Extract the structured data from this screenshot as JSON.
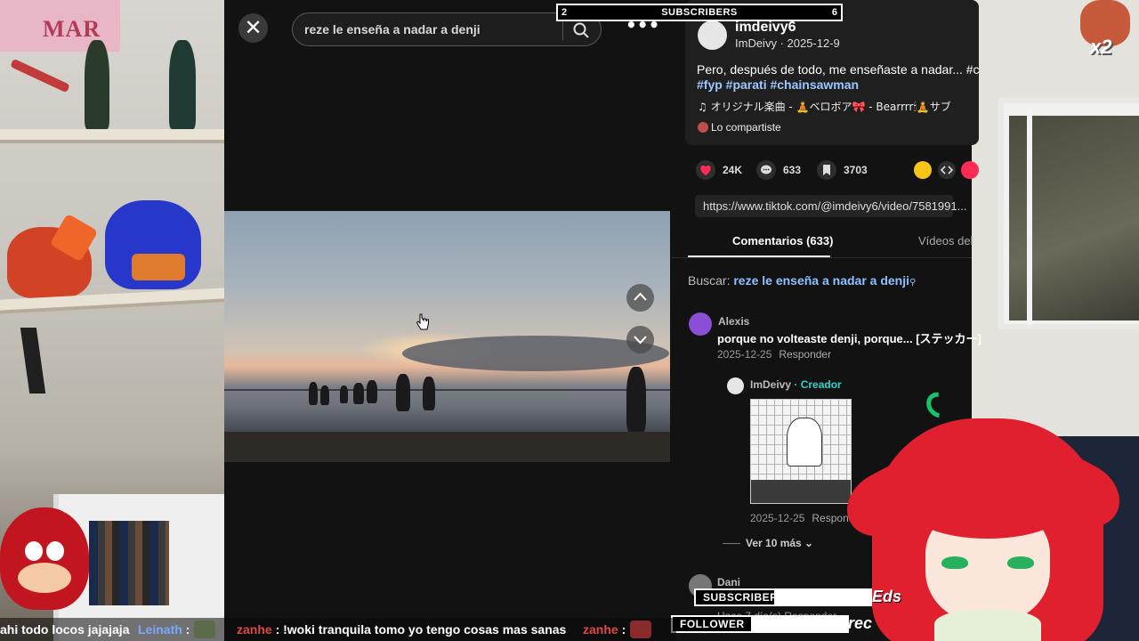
{
  "search": {
    "query": "reze le enseña a nadar a denji"
  },
  "post": {
    "handle": "imdeivy6",
    "author_line": "ImDeivy · 2025-12-9",
    "description": "Pero, después de todo, me enseñaste a nadar... #c",
    "hashtags": "#fyp #parati #chainsawman",
    "music": "♫  オリジナル楽曲 - 🧘ベロボア🎀 - Bearrrr🕯🧘サブ",
    "shared": "Lo compartiste",
    "likes": "24K",
    "comments": "633",
    "saves": "3703",
    "link": "https://www.tiktok.com/@imdeivy6/video/7581991..."
  },
  "tabs": {
    "comments": "Comentarios (633)",
    "videos": "Vídeos del"
  },
  "comment_search": {
    "prefix": "Buscar:",
    "query": "reze le enseña a nadar a denji"
  },
  "comments": [
    {
      "name": "Alexis",
      "text": "porque no volteaste denji, porque... [ステッカー]",
      "date": "2025-12-25",
      "reply": "Responder"
    },
    {
      "name": "ImDeivy",
      "tag": "· Creador",
      "date": "2025-12-25",
      "reply": "Responder"
    },
    {
      "name": "Dani",
      "meta": "Hace 7 día(s)   Responder"
    }
  ],
  "more_replies": "Ver 10 más",
  "overlay": {
    "subs_left": "2",
    "subs_title": "SUBSCRIBERS",
    "subs_right": "6",
    "subs_label": "SUBSCRIBERS",
    "subs_name": "Eds",
    "follower_label": "FOLLOWER",
    "follower_name": "rec",
    "emote_mult": "x2"
  },
  "chat": [
    {
      "user": "",
      "text": "ahi todo locos jajajaja"
    },
    {
      "user": "Leinath",
      "text": ":"
    },
    {
      "user": "zanhe",
      "text": ": !woki tranquila tomo yo tengo cosas mas sanas"
    },
    {
      "user": "zanhe",
      "text": ":"
    }
  ],
  "poster_text": "MAR",
  "colors": {
    "accent_link": "#8ec1ff",
    "creator": "#2dd4c9",
    "like": "#fe2c55",
    "panel": "#121212"
  }
}
